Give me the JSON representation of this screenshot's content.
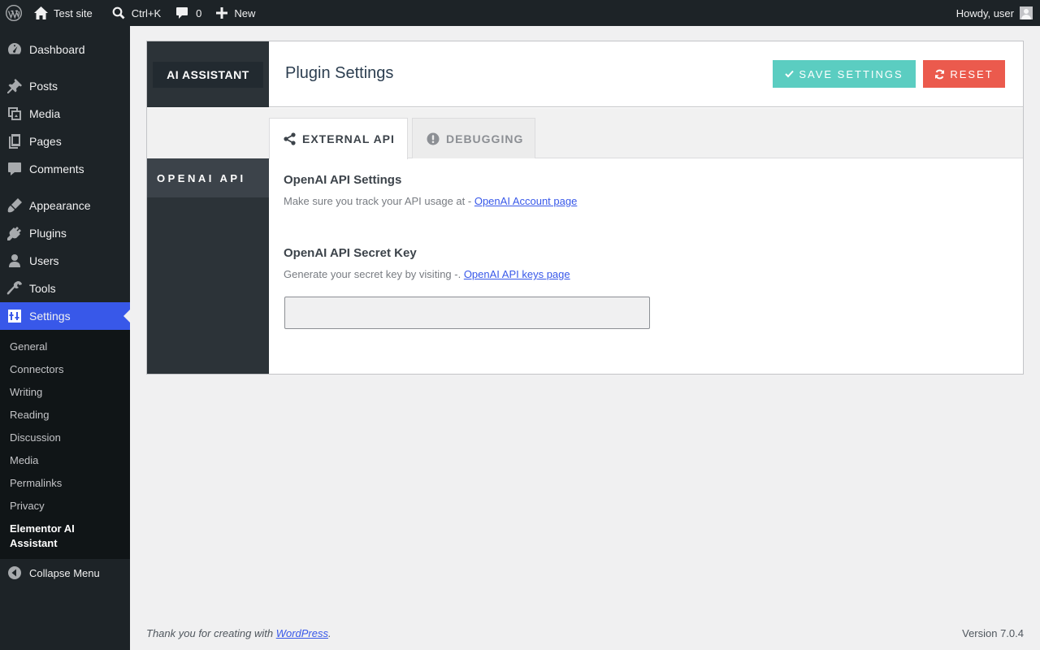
{
  "adminbar": {
    "site_name": "Test site",
    "search_shortcut": "Ctrl+K",
    "comments_count": "0",
    "new_label": "New",
    "greeting": "Howdy, user"
  },
  "sidebar": {
    "items": [
      {
        "label": "Dashboard",
        "icon": "dashboard-icon"
      },
      {
        "label": "Posts",
        "icon": "pin-icon"
      },
      {
        "label": "Media",
        "icon": "media-icon"
      },
      {
        "label": "Pages",
        "icon": "pages-icon"
      },
      {
        "label": "Comments",
        "icon": "comment-icon"
      },
      {
        "label": "Appearance",
        "icon": "brush-icon"
      },
      {
        "label": "Plugins",
        "icon": "plug-icon"
      },
      {
        "label": "Users",
        "icon": "user-icon"
      },
      {
        "label": "Tools",
        "icon": "wrench-icon"
      },
      {
        "label": "Settings",
        "icon": "settings-icon"
      }
    ],
    "submenu": [
      "General",
      "Connectors",
      "Writing",
      "Reading",
      "Discussion",
      "Media",
      "Permalinks",
      "Privacy",
      "Elementor AI Assistant"
    ],
    "collapse_label": "Collapse Menu"
  },
  "plugin": {
    "logo_text": "AI ASSISTANT",
    "page_title": "Plugin Settings",
    "save_label": "SAVE SETTINGS",
    "reset_label": "RESET",
    "side_section": "OPENAI API",
    "tabs": [
      "EXTERNAL API",
      "DEBUGGING"
    ],
    "api_settings_title": "OpenAI API Settings",
    "api_settings_desc": "Make sure you track your API usage at - ",
    "api_settings_link": "OpenAI Account page",
    "secret_key_title": "OpenAI API Secret Key",
    "secret_key_desc": "Generate your secret key by visiting -. ",
    "secret_key_link": "OpenAI API keys page",
    "secret_key_value": ""
  },
  "footer": {
    "thanks_prefix": "Thank you for creating with ",
    "thanks_link": "WordPress",
    "thanks_suffix": ".",
    "version": "Version 7.0.4"
  },
  "colors": {
    "adminbar_bg": "#1d2327",
    "accent": "#3858e9",
    "save_button": "#5bcdc1",
    "reset_button": "#eb5a4d"
  }
}
